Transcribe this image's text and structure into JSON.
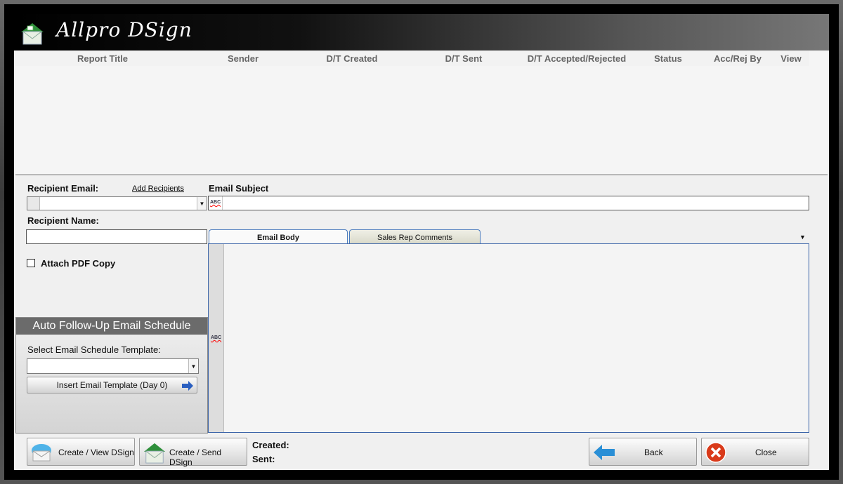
{
  "app": {
    "title": "Allpro DSign"
  },
  "grid": {
    "columns": [
      "Report Title",
      "Sender",
      "D/T Created",
      "D/T Sent",
      "D/T Accepted/Rejected",
      "Status",
      "Acc/Rej By",
      "View"
    ]
  },
  "form": {
    "recipient_email_label": "Recipient Email:",
    "add_recipients_link": "Add Recipients",
    "email_subject_label": "Email Subject",
    "recipient_name_label": "Recipient Name:",
    "attach_pdf_label": "Attach PDF Copy",
    "attach_pdf_checked": false,
    "recipient_email_value": "",
    "email_subject_value": "",
    "recipient_name_value": ""
  },
  "tabs": [
    {
      "label": "Email Body",
      "active": true
    },
    {
      "label": "Sales Rep Comments",
      "active": false
    }
  ],
  "schedule": {
    "header": "Auto Follow-Up Email Schedule",
    "select_label": "Select Email Schedule Template:",
    "select_value": "",
    "insert_button": "Insert Email Template (Day 0)"
  },
  "footer": {
    "create_view_button": "Create / View DSign",
    "create_send_button": "Create / Send DSign",
    "created_label": "Created:",
    "sent_label": "Sent:",
    "back_button": "Back",
    "close_button": "Close"
  },
  "icons": {
    "logo": "house-envelope-icon",
    "spell": "spellcheck-icon",
    "insert_arrow": "arrow-right-icon",
    "back": "arrow-left-icon",
    "close": "close-circle-icon"
  },
  "colors": {
    "accent": "#3a63a8",
    "close_red": "#d93a1a",
    "back_blue": "#2a8fd6",
    "house_green": "#2e8f3a"
  }
}
